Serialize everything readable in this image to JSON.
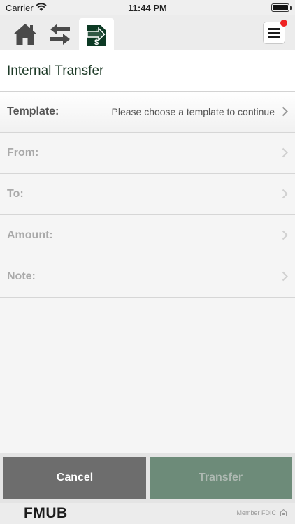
{
  "status_bar": {
    "carrier": "Carrier",
    "time": "11:44 PM",
    "battery_level": 1.0
  },
  "nav": {
    "icons": [
      "home-icon",
      "transfer-arrows-icon",
      "internal-transfer-icon",
      "hamburger-menu-icon"
    ],
    "active_color": "#0c3a24",
    "badge_color": "#e22222"
  },
  "page": {
    "title": "Internal Transfer"
  },
  "form": {
    "template": {
      "label": "Template:",
      "value": "Please choose a template to continue"
    },
    "from": {
      "label": "From:"
    },
    "to": {
      "label": "To:"
    },
    "amount": {
      "label": "Amount:"
    },
    "note": {
      "label": "Note:"
    }
  },
  "actions": {
    "cancel_label": "Cancel",
    "transfer_label": "Transfer"
  },
  "footer": {
    "brand": "FMUB",
    "fdic": "Member FDIC",
    "lender_icon": "equal-housing-lender-icon"
  }
}
